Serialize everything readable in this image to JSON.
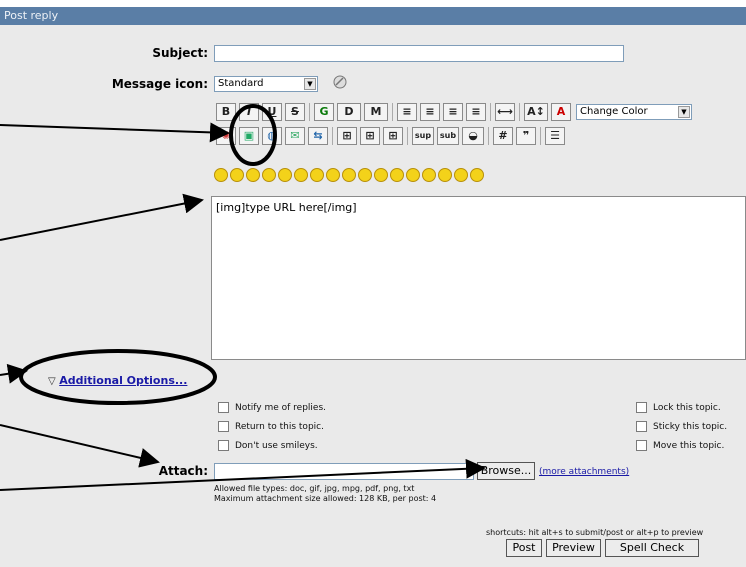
{
  "window": {
    "title": "Post reply"
  },
  "form": {
    "subject_label": "Subject:",
    "subject_value": "",
    "icon_label": "Message icon:",
    "icon_selected": "Standard",
    "change_color_label": "Change Color",
    "toolbar_row1": [
      "B",
      "I",
      "U",
      "S",
      "G",
      "D",
      "M",
      "left-align",
      "center-align",
      "right-align",
      "justify",
      "hr",
      "font-size",
      "font-color"
    ],
    "message_body": "[img]type URL here[/img]",
    "additional_options_label": "Additional Options...",
    "options_left": [
      "Notify me of replies.",
      "Return to this topic.",
      "Don't use smileys."
    ],
    "options_right": [
      "Lock this topic.",
      "Sticky this topic.",
      "Move this topic."
    ],
    "attach_label": "Attach:",
    "browse_label": "Browse...",
    "more_attachments_label": "(more attachments)",
    "allowed_types": "Allowed file types: doc, gif, jpg, mpg, pdf, png, txt",
    "max_size": "Maximum attachment size allowed: 128 KB, per post: 4",
    "shortcuts": "shortcuts: hit alt+s to submit/post or alt+p to preview",
    "post_label": "Post",
    "preview_label": "Preview",
    "spellcheck_label": "Spell Check"
  },
  "annotations": {
    "arrows": 5,
    "ellipses": [
      "image-button",
      "additional-options"
    ]
  }
}
